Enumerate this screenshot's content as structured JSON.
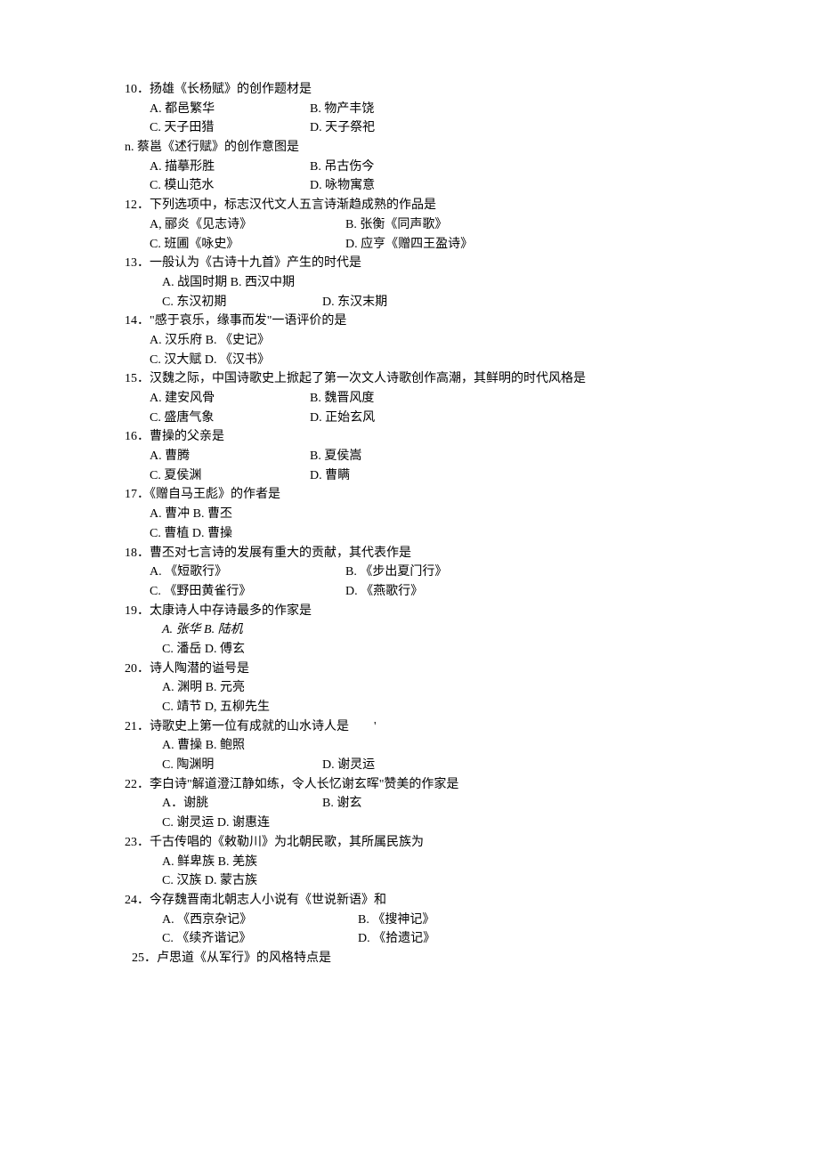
{
  "q10": {
    "num": "10",
    "stem": "．扬雄《长杨赋》的创作题材是",
    "a": "A. 都邑繁华",
    "b": "B. 物产丰饶",
    "c": "C. 天子田猎",
    "d": "D. 天子祭祀"
  },
  "q11": {
    "num": "n.",
    "stem": " 蔡邕《述行赋》的创作意图是",
    "a": "A. 描摹形胜",
    "b": "B. 吊古伤今",
    "c": "C. 模山范水",
    "d": "D. 咏物寓意"
  },
  "q12": {
    "num": "12",
    "stem": "．下列选项中，标志汉代文人五言诗渐趋成熟的作品是",
    "a": "A, 郦炎《见志诗》",
    "b": "B. 张衡《同声歌》",
    "c": "C. 班圃《咏史》",
    "d": "D. 应亨《赠四王盈诗》"
  },
  "q13": {
    "num": "13",
    "stem": "．一般认为《古诗十九首》产生的时代是",
    "ab": "A. 战国时期 B. 西汉中期",
    "c": "C. 东汉初期",
    "d": "D. 东汉末期"
  },
  "q14": {
    "num": "14",
    "stem": "．\"感于哀乐，缘事而发\"一语评价的是",
    "ab": "A. 汉乐府 B. 《史记》",
    "cd": "C. 汉大赋 D. 《汉书》"
  },
  "q15": {
    "num": "15",
    "stem": "．汉魏之际，中国诗歌史上掀起了第一次文人诗歌创作高潮，其鲜明的时代风格是",
    "a": "A. 建安风骨",
    "b": "B. 魏晋风度",
    "c": "C. 盛唐气象",
    "d": "D. 正始玄风"
  },
  "q16": {
    "num": "16",
    "stem": "．曹操的父亲是",
    "a": "A. 曹腾",
    "b": "B. 夏侯嵩",
    "c": "C. 夏侯渊",
    "d": "D. 曹瞒"
  },
  "q17": {
    "num": "17",
    "stem": "．《赠自马王彪》的作者是",
    "ab": "A. 曹冲 B. 曹丕",
    "cd": "C. 曹植 D. 曹操"
  },
  "q18": {
    "num": "18",
    "stem": "．曹丕对七言诗的发展有重大的贡献，其代表作是",
    "a": "A. 《短歌行》",
    "b": "B. 《步出夏门行》",
    "c": "C. 《野田黄雀行》",
    "d": "D. 《燕歌行》"
  },
  "q19": {
    "num": "19",
    "stem": "．太康诗人中存诗最多的作家是",
    "ab": "A. 张华 B. 陆机",
    "cd": "C. 潘岳 D. 傅玄"
  },
  "q20": {
    "num": "20",
    "stem": "．诗人陶潜的谥号是",
    "ab": "A. 渊明 B. 元亮",
    "cd": "C. 靖节 D, 五柳先生"
  },
  "q21": {
    "num": "21",
    "stem": "．诗歌史上第一位有成就的山水诗人是　　'",
    "ab": "A. 曹操 B. 鲍照",
    "c": "C. 陶渊明",
    "d": "D. 谢灵运"
  },
  "q22": {
    "num": "22",
    "stem": "．李白诗\"解道澄江静如练，令人长忆谢玄晖\"赞美的作家是",
    "a": "A．谢朓",
    "b": "B. 谢玄",
    "cd": "C. 谢灵运 D. 谢惠连"
  },
  "q23": {
    "num": "23",
    "stem": "．千古传唱的《敕勒川》为北朝民歌，其所属民族为",
    "ab": "A. 鲜卑族 B. 羌族",
    "cd": "C. 汉族 D. 蒙古族"
  },
  "q24": {
    "num": "24",
    "stem": "．今存魏晋南北朝志人小说有《世说新语》和",
    "a": "A. 《西京杂记》",
    "b": "B. 《搜神记》",
    "c": "C. 《续齐谐记》",
    "d": "D. 《拾遗记》"
  },
  "q25": {
    "num": "25",
    "stem": "．卢思道《从军行》的风格特点是"
  }
}
